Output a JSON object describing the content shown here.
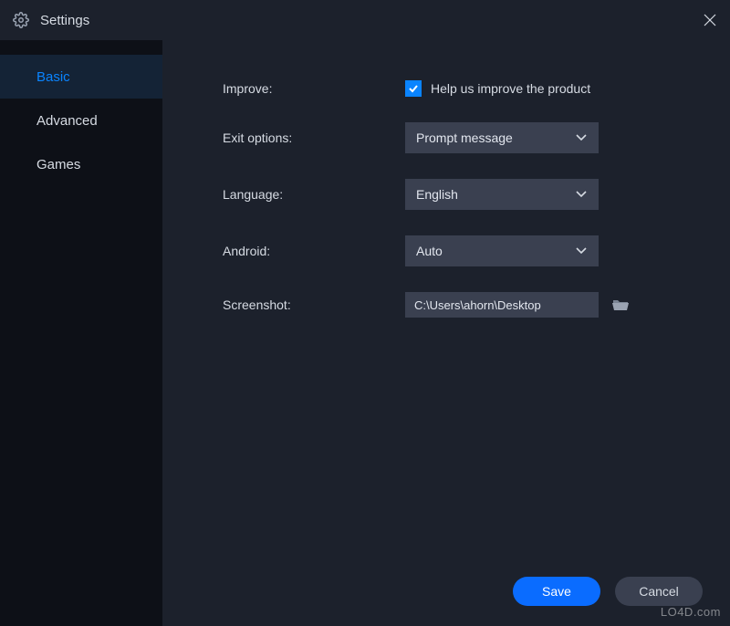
{
  "titlebar": {
    "title": "Settings"
  },
  "sidebar": {
    "items": [
      {
        "label": "Basic",
        "active": true
      },
      {
        "label": "Advanced",
        "active": false
      },
      {
        "label": "Games",
        "active": false
      }
    ]
  },
  "settings": {
    "improve": {
      "label": "Improve:",
      "checkbox_label": "Help us improve the product",
      "checked": true
    },
    "exit": {
      "label": "Exit options:",
      "value": "Prompt message"
    },
    "language": {
      "label": "Language:",
      "value": "English"
    },
    "android": {
      "label": "Android:",
      "value": "Auto"
    },
    "screenshot": {
      "label": "Screenshot:",
      "value": "C:\\Users\\ahorn\\Desktop"
    }
  },
  "footer": {
    "save": "Save",
    "cancel": "Cancel"
  },
  "watermark": "LO4D.com",
  "colors": {
    "accent": "#0a84ff",
    "primary_btn": "#0a6cff",
    "panel": "#1c212c",
    "sidebar": "#0d1017",
    "control": "#3a4050"
  }
}
